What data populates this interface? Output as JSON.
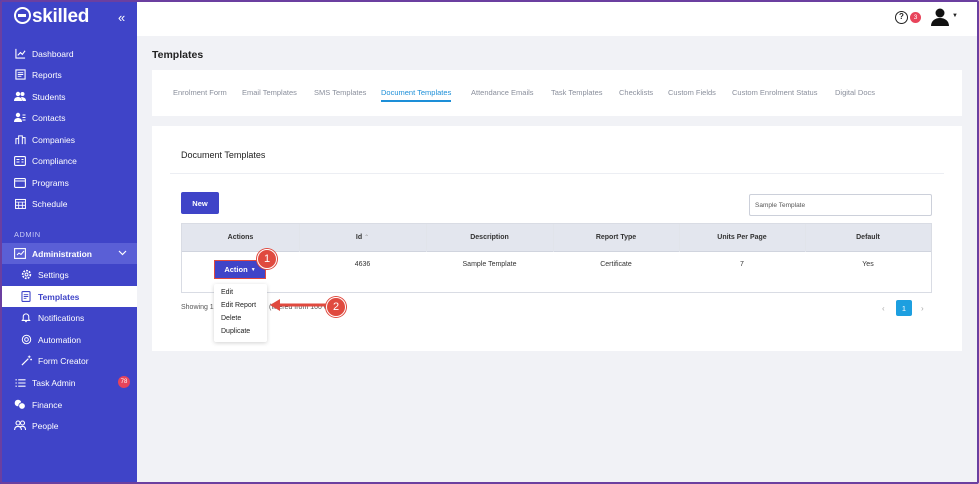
{
  "app": {
    "brand": "skilled",
    "collapse_icon": "«"
  },
  "sidebar": {
    "items": [
      {
        "label": "Dashboard",
        "icon": "chart-line-icon"
      },
      {
        "label": "Reports",
        "icon": "report-icon"
      },
      {
        "label": "Students",
        "icon": "users-icon"
      },
      {
        "label": "Contacts",
        "icon": "contact-icon"
      },
      {
        "label": "Companies",
        "icon": "building-icon"
      },
      {
        "label": "Compliance",
        "icon": "id-card-icon"
      },
      {
        "label": "Programs",
        "icon": "window-icon"
      },
      {
        "label": "Schedule",
        "icon": "calendar-icon"
      }
    ],
    "admin_heading": "ADMIN",
    "admin": {
      "label": "Administration",
      "icon": "admin-icon"
    },
    "sub_items": [
      {
        "label": "Settings",
        "icon": "gear-icon"
      },
      {
        "label": "Templates",
        "icon": "template-icon"
      },
      {
        "label": "Notifications",
        "icon": "bell-icon"
      },
      {
        "label": "Automation",
        "icon": "automation-icon"
      },
      {
        "label": "Form Creator",
        "icon": "wand-icon"
      }
    ],
    "bottom_items": [
      {
        "label": "Task Admin",
        "icon": "list-icon",
        "badge": "78"
      },
      {
        "label": "Finance",
        "icon": "coins-icon"
      },
      {
        "label": "People",
        "icon": "people-icon"
      }
    ]
  },
  "topbar": {
    "help_icon": "?",
    "notification_count": "3"
  },
  "page": {
    "title": "Templates",
    "tabs": [
      "Enrolment Form",
      "Email Templates",
      "SMS Templates",
      "Document Templates",
      "Attendance Emails",
      "Task Templates",
      "Checklists",
      "Custom Fields",
      "Custom Enrolment Status",
      "Digital Docs"
    ],
    "active_tab": "Document Templates"
  },
  "document_templates": {
    "heading": "Document Templates",
    "new_button": "New",
    "search_value": "Sample Template",
    "columns": [
      "Actions",
      "Id",
      "Description",
      "Report Type",
      "Units Per Page",
      "Default"
    ],
    "sort_indicator": "⌃",
    "row": {
      "action_label": "Action",
      "id": "4636",
      "description": "Sample Template",
      "report_type": "Certificate",
      "units_per_page": "7",
      "default": "Yes"
    },
    "action_menu": [
      "Edit",
      "Edit Report",
      "Delete",
      "Duplicate"
    ],
    "showing_prefix": "Showing 1",
    "showing_suffix": "(filtered from 100 entries)",
    "pagination": {
      "prev": "‹",
      "current": "1",
      "next": "›"
    }
  },
  "callouts": [
    "1",
    "2"
  ],
  "colors": {
    "sidebar": "#3f44c8",
    "accent": "#1d8fd8",
    "callout": "#e04a3f",
    "badge": "#e8435a"
  }
}
